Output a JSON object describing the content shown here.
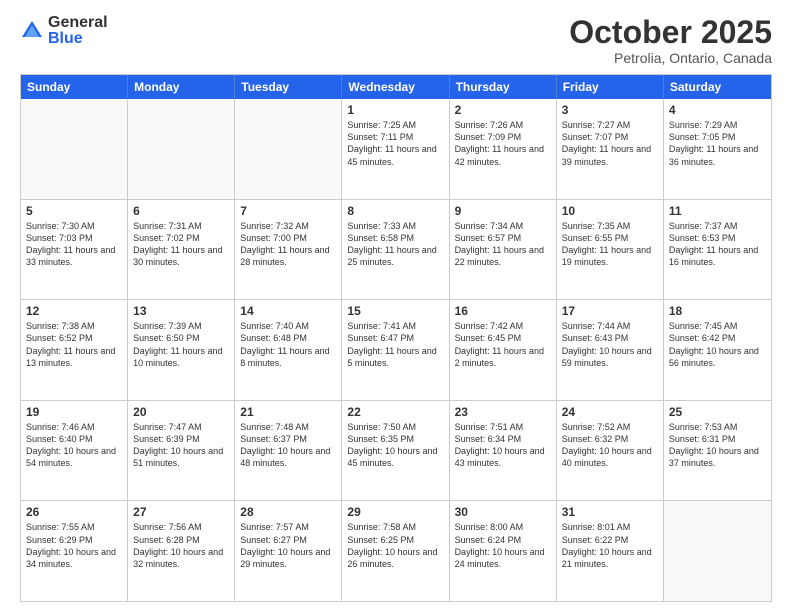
{
  "logo": {
    "general": "General",
    "blue": "Blue"
  },
  "header": {
    "month": "October 2025",
    "location": "Petrolia, Ontario, Canada"
  },
  "days": [
    "Sunday",
    "Monday",
    "Tuesday",
    "Wednesday",
    "Thursday",
    "Friday",
    "Saturday"
  ],
  "weeks": [
    [
      {
        "day": "",
        "sunrise": "",
        "sunset": "",
        "daylight": ""
      },
      {
        "day": "",
        "sunrise": "",
        "sunset": "",
        "daylight": ""
      },
      {
        "day": "",
        "sunrise": "",
        "sunset": "",
        "daylight": ""
      },
      {
        "day": "1",
        "sunrise": "Sunrise: 7:25 AM",
        "sunset": "Sunset: 7:11 PM",
        "daylight": "Daylight: 11 hours and 45 minutes."
      },
      {
        "day": "2",
        "sunrise": "Sunrise: 7:26 AM",
        "sunset": "Sunset: 7:09 PM",
        "daylight": "Daylight: 11 hours and 42 minutes."
      },
      {
        "day": "3",
        "sunrise": "Sunrise: 7:27 AM",
        "sunset": "Sunset: 7:07 PM",
        "daylight": "Daylight: 11 hours and 39 minutes."
      },
      {
        "day": "4",
        "sunrise": "Sunrise: 7:29 AM",
        "sunset": "Sunset: 7:05 PM",
        "daylight": "Daylight: 11 hours and 36 minutes."
      }
    ],
    [
      {
        "day": "5",
        "sunrise": "Sunrise: 7:30 AM",
        "sunset": "Sunset: 7:03 PM",
        "daylight": "Daylight: 11 hours and 33 minutes."
      },
      {
        "day": "6",
        "sunrise": "Sunrise: 7:31 AM",
        "sunset": "Sunset: 7:02 PM",
        "daylight": "Daylight: 11 hours and 30 minutes."
      },
      {
        "day": "7",
        "sunrise": "Sunrise: 7:32 AM",
        "sunset": "Sunset: 7:00 PM",
        "daylight": "Daylight: 11 hours and 28 minutes."
      },
      {
        "day": "8",
        "sunrise": "Sunrise: 7:33 AM",
        "sunset": "Sunset: 6:58 PM",
        "daylight": "Daylight: 11 hours and 25 minutes."
      },
      {
        "day": "9",
        "sunrise": "Sunrise: 7:34 AM",
        "sunset": "Sunset: 6:57 PM",
        "daylight": "Daylight: 11 hours and 22 minutes."
      },
      {
        "day": "10",
        "sunrise": "Sunrise: 7:35 AM",
        "sunset": "Sunset: 6:55 PM",
        "daylight": "Daylight: 11 hours and 19 minutes."
      },
      {
        "day": "11",
        "sunrise": "Sunrise: 7:37 AM",
        "sunset": "Sunset: 6:53 PM",
        "daylight": "Daylight: 11 hours and 16 minutes."
      }
    ],
    [
      {
        "day": "12",
        "sunrise": "Sunrise: 7:38 AM",
        "sunset": "Sunset: 6:52 PM",
        "daylight": "Daylight: 11 hours and 13 minutes."
      },
      {
        "day": "13",
        "sunrise": "Sunrise: 7:39 AM",
        "sunset": "Sunset: 6:50 PM",
        "daylight": "Daylight: 11 hours and 10 minutes."
      },
      {
        "day": "14",
        "sunrise": "Sunrise: 7:40 AM",
        "sunset": "Sunset: 6:48 PM",
        "daylight": "Daylight: 11 hours and 8 minutes."
      },
      {
        "day": "15",
        "sunrise": "Sunrise: 7:41 AM",
        "sunset": "Sunset: 6:47 PM",
        "daylight": "Daylight: 11 hours and 5 minutes."
      },
      {
        "day": "16",
        "sunrise": "Sunrise: 7:42 AM",
        "sunset": "Sunset: 6:45 PM",
        "daylight": "Daylight: 11 hours and 2 minutes."
      },
      {
        "day": "17",
        "sunrise": "Sunrise: 7:44 AM",
        "sunset": "Sunset: 6:43 PM",
        "daylight": "Daylight: 10 hours and 59 minutes."
      },
      {
        "day": "18",
        "sunrise": "Sunrise: 7:45 AM",
        "sunset": "Sunset: 6:42 PM",
        "daylight": "Daylight: 10 hours and 56 minutes."
      }
    ],
    [
      {
        "day": "19",
        "sunrise": "Sunrise: 7:46 AM",
        "sunset": "Sunset: 6:40 PM",
        "daylight": "Daylight: 10 hours and 54 minutes."
      },
      {
        "day": "20",
        "sunrise": "Sunrise: 7:47 AM",
        "sunset": "Sunset: 6:39 PM",
        "daylight": "Daylight: 10 hours and 51 minutes."
      },
      {
        "day": "21",
        "sunrise": "Sunrise: 7:48 AM",
        "sunset": "Sunset: 6:37 PM",
        "daylight": "Daylight: 10 hours and 48 minutes."
      },
      {
        "day": "22",
        "sunrise": "Sunrise: 7:50 AM",
        "sunset": "Sunset: 6:35 PM",
        "daylight": "Daylight: 10 hours and 45 minutes."
      },
      {
        "day": "23",
        "sunrise": "Sunrise: 7:51 AM",
        "sunset": "Sunset: 6:34 PM",
        "daylight": "Daylight: 10 hours and 43 minutes."
      },
      {
        "day": "24",
        "sunrise": "Sunrise: 7:52 AM",
        "sunset": "Sunset: 6:32 PM",
        "daylight": "Daylight: 10 hours and 40 minutes."
      },
      {
        "day": "25",
        "sunrise": "Sunrise: 7:53 AM",
        "sunset": "Sunset: 6:31 PM",
        "daylight": "Daylight: 10 hours and 37 minutes."
      }
    ],
    [
      {
        "day": "26",
        "sunrise": "Sunrise: 7:55 AM",
        "sunset": "Sunset: 6:29 PM",
        "daylight": "Daylight: 10 hours and 34 minutes."
      },
      {
        "day": "27",
        "sunrise": "Sunrise: 7:56 AM",
        "sunset": "Sunset: 6:28 PM",
        "daylight": "Daylight: 10 hours and 32 minutes."
      },
      {
        "day": "28",
        "sunrise": "Sunrise: 7:57 AM",
        "sunset": "Sunset: 6:27 PM",
        "daylight": "Daylight: 10 hours and 29 minutes."
      },
      {
        "day": "29",
        "sunrise": "Sunrise: 7:58 AM",
        "sunset": "Sunset: 6:25 PM",
        "daylight": "Daylight: 10 hours and 26 minutes."
      },
      {
        "day": "30",
        "sunrise": "Sunrise: 8:00 AM",
        "sunset": "Sunset: 6:24 PM",
        "daylight": "Daylight: 10 hours and 24 minutes."
      },
      {
        "day": "31",
        "sunrise": "Sunrise: 8:01 AM",
        "sunset": "Sunset: 6:22 PM",
        "daylight": "Daylight: 10 hours and 21 minutes."
      },
      {
        "day": "",
        "sunrise": "",
        "sunset": "",
        "daylight": ""
      }
    ]
  ]
}
